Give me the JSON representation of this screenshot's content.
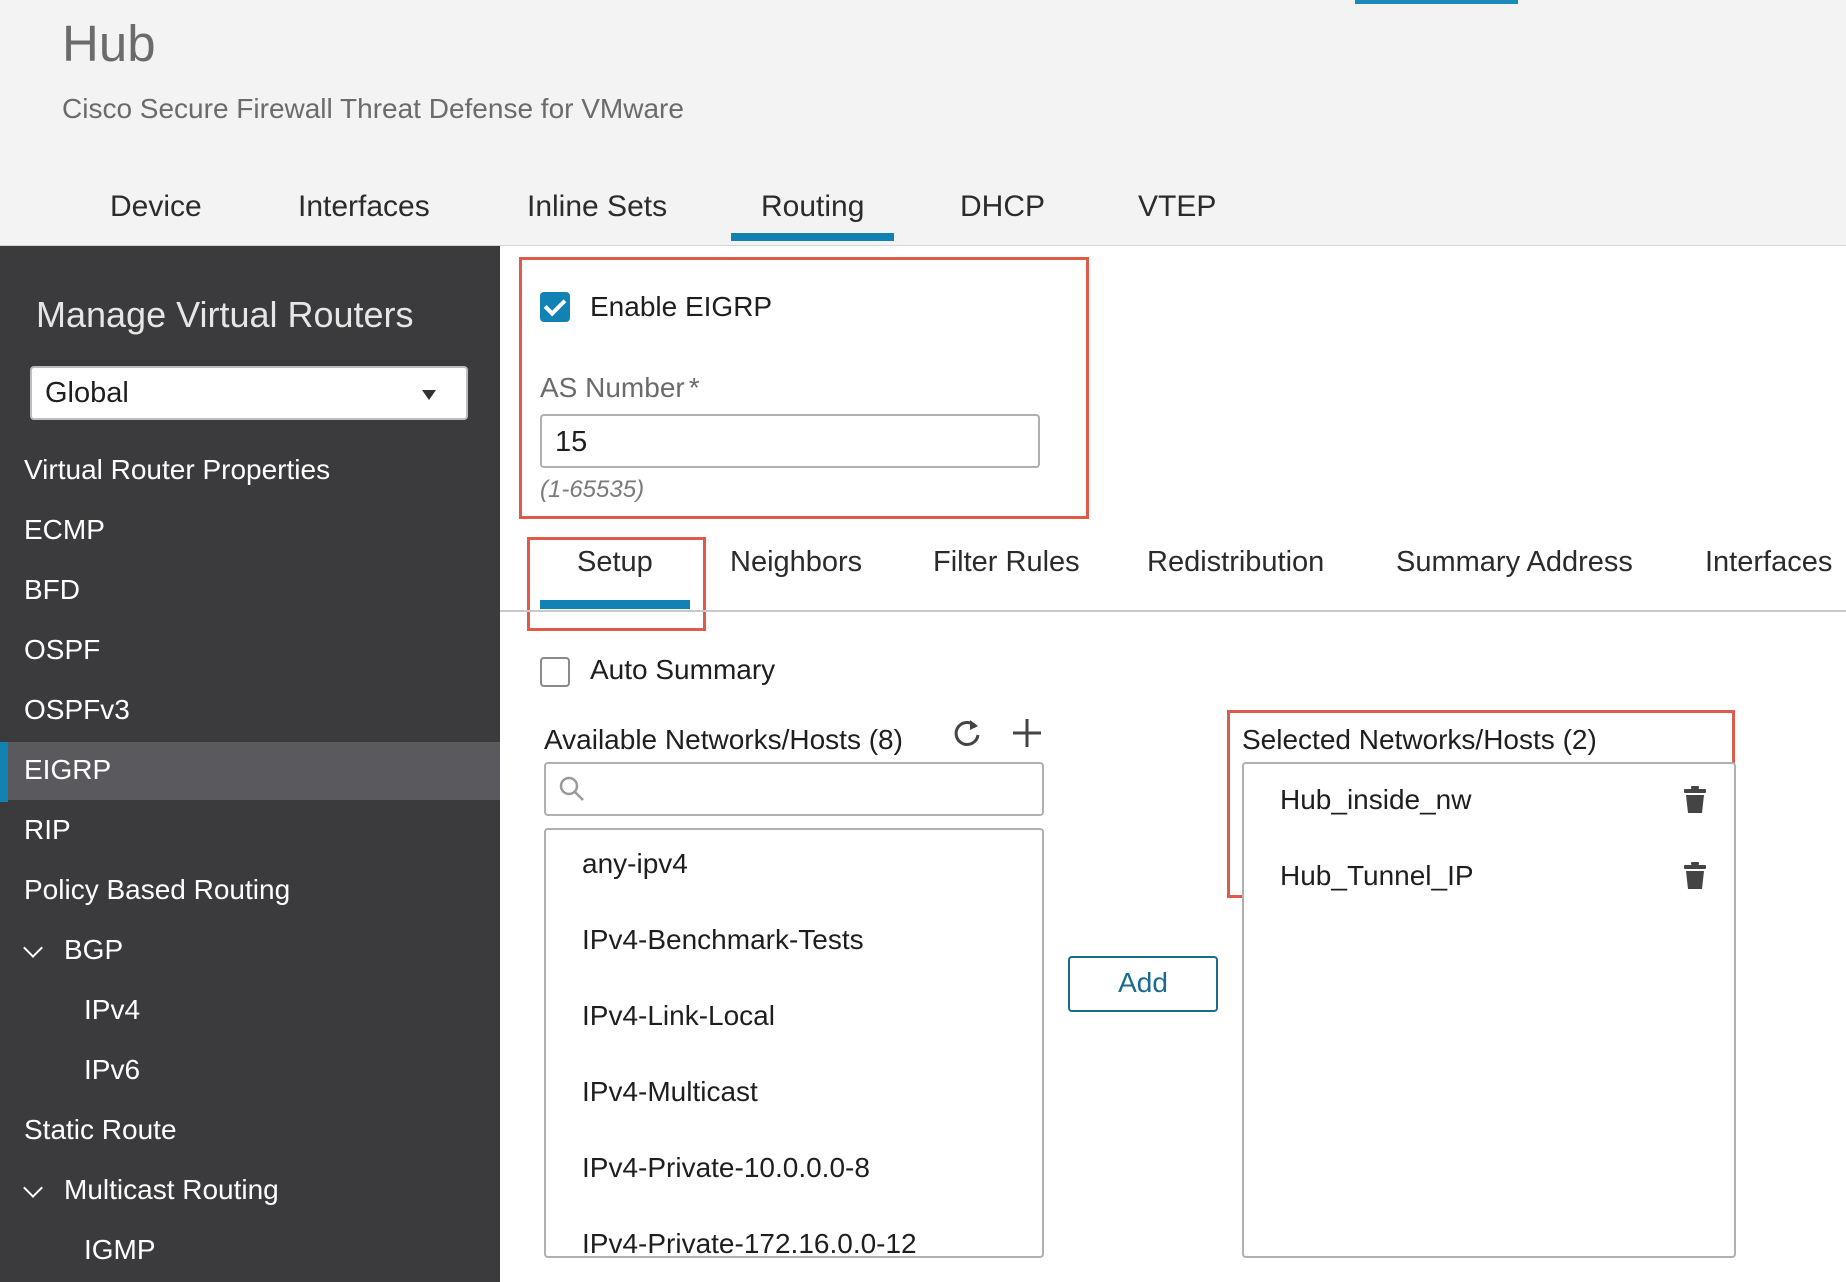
{
  "header": {
    "title": "Hub",
    "subtitle": "Cisco Secure Firewall Threat Defense for VMware",
    "tabs": [
      "Device",
      "Interfaces",
      "Inline Sets",
      "Routing",
      "DHCP",
      "VTEP"
    ],
    "active_tab": "Routing"
  },
  "sidebar": {
    "title": "Manage Virtual Routers",
    "router_select": "Global",
    "items": [
      {
        "label": "Virtual Router Properties"
      },
      {
        "label": "ECMP"
      },
      {
        "label": "BFD"
      },
      {
        "label": "OSPF"
      },
      {
        "label": "OSPFv3"
      },
      {
        "label": "EIGRP"
      },
      {
        "label": "RIP"
      },
      {
        "label": "Policy Based Routing"
      },
      {
        "label": "BGP"
      },
      {
        "label": "IPv4"
      },
      {
        "label": "IPv6"
      },
      {
        "label": "Static Route"
      },
      {
        "label": "Multicast Routing"
      },
      {
        "label": "IGMP"
      }
    ],
    "active_item": "EIGRP"
  },
  "eigrp": {
    "enable_label": "Enable EIGRP",
    "enable_checked": true,
    "as_label": "AS Number",
    "as_required": "*",
    "as_value": "15",
    "as_hint": "(1-65535)"
  },
  "sub_tabs": [
    "Setup",
    "Neighbors",
    "Filter Rules",
    "Redistribution",
    "Summary Address",
    "Interfaces"
  ],
  "active_sub_tab": "Setup",
  "setup": {
    "auto_summary_label": "Auto Summary",
    "auto_summary_checked": false,
    "available_title": "Available Networks/Hosts (8)",
    "search_placeholder": "",
    "available_items": [
      "any-ipv4",
      "IPv4-Benchmark-Tests",
      "IPv4-Link-Local",
      "IPv4-Multicast",
      "IPv4-Private-10.0.0.0-8",
      "IPv4-Private-172.16.0.0-12"
    ],
    "add_label": "Add",
    "selected_title": "Selected Networks/Hosts (2)",
    "selected_items": [
      "Hub_inside_nw",
      "Hub_Tunnel_IP"
    ]
  },
  "icons": {
    "refresh": "refresh-icon",
    "add": "plus-icon",
    "search": "search-icon",
    "delete": "trash-icon",
    "expand": "chevron-down-icon"
  },
  "colors": {
    "accent": "#1182b3",
    "highlight": "#df5a48",
    "sidebar_bg": "#3b3b3d"
  }
}
